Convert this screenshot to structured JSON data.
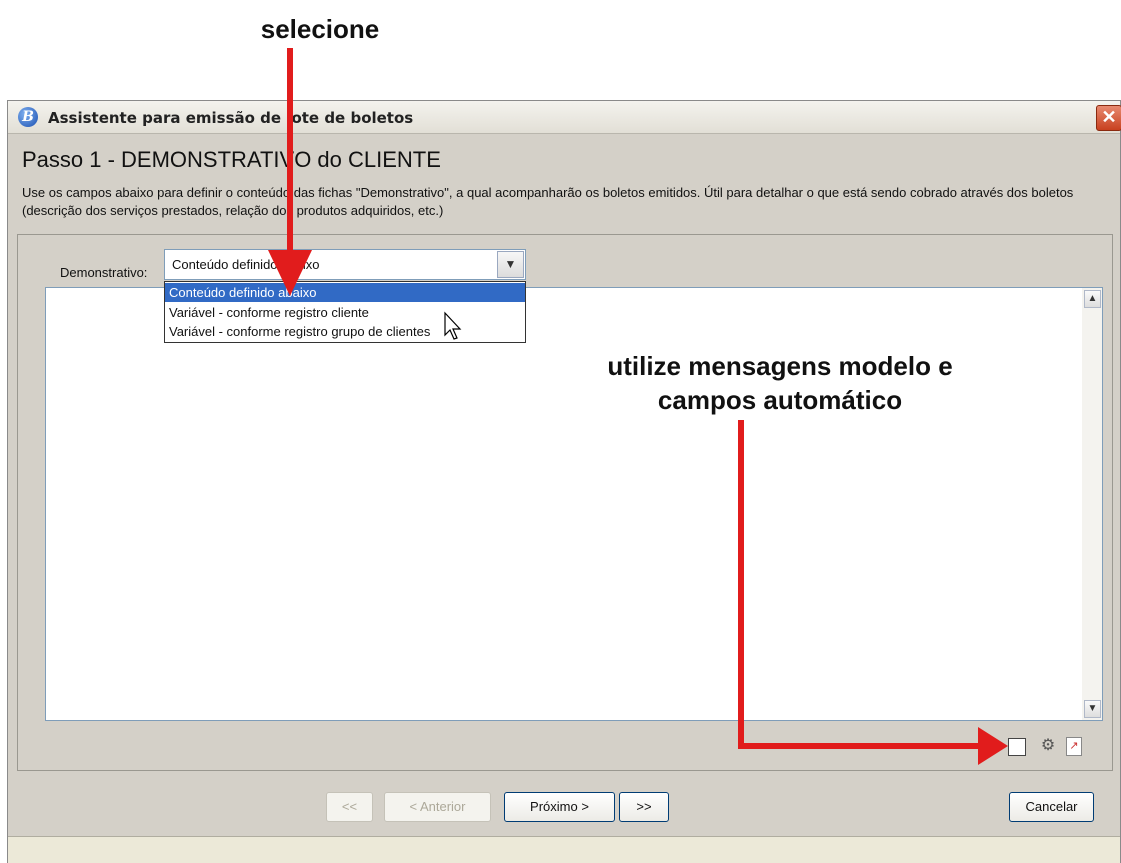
{
  "annotations": {
    "select_label": "selecione",
    "tools_label_line1": "utilize mensagens modelo e",
    "tools_label_line2": "campos automático",
    "arrow_color": "#e11c1c"
  },
  "window": {
    "title": "Assistente para emissão de lote de boletos",
    "app_icon": "B",
    "close_glyph": "✕"
  },
  "step": {
    "title": "Passo 1 - DEMONSTRATIVO do CLIENTE",
    "description": "Use os campos abaixo para definir o conteúdo das fichas \"Demonstrativo\", a qual acompanharão os boletos emitidos. Útil para detalhar o que está sendo cobrado através dos boletos (descrição dos serviços prestados, relação dos produtos adquiridos, etc.)"
  },
  "demonstrativo": {
    "label": "Demonstrativo:",
    "selected": "Conteúdo definido abaixo",
    "options": [
      "Conteúdo definido abaixo",
      "Variável - conforme registro cliente",
      "Variável - conforme registro grupo de clientes"
    ]
  },
  "toolbar_icons": [
    "template-icon",
    "auto-fields-icon",
    "document-icon"
  ],
  "buttons": {
    "first": "<<",
    "previous": "< Anterior",
    "next": "Próximo >",
    "last": ">>",
    "cancel": "Cancelar"
  }
}
